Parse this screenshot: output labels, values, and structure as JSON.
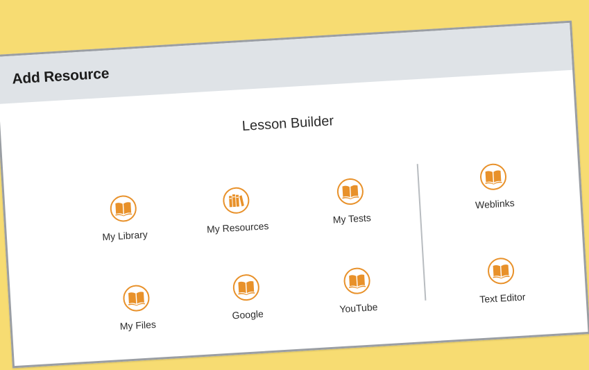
{
  "dialog": {
    "title": "Add Resource",
    "section_title": "Lesson Builder"
  },
  "tiles": {
    "my_library": {
      "label": "My Library",
      "icon": "open-book-icon"
    },
    "my_resources": {
      "label": "My Resources",
      "icon": "books-shelf-icon"
    },
    "my_tests": {
      "label": "My Tests",
      "icon": "open-book-icon"
    },
    "my_files": {
      "label": "My Files",
      "icon": "open-book-icon"
    },
    "google": {
      "label": "Google",
      "icon": "open-book-icon"
    },
    "youtube": {
      "label": "YouTube",
      "icon": "open-book-icon"
    },
    "weblinks": {
      "label": "Weblinks",
      "icon": "open-book-icon"
    },
    "text_editor": {
      "label": "Text Editor",
      "icon": "open-book-icon"
    }
  },
  "colors": {
    "accent": "#e8912a",
    "header_bg": "#dfe3e7",
    "page_bg": "#f7dc72",
    "border": "#9a9ea3"
  }
}
